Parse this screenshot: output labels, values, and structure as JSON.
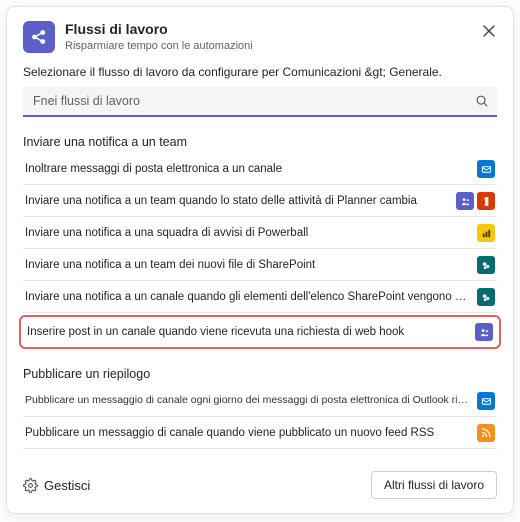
{
  "header": {
    "title": "Flussi di lavoro",
    "subtitle": "Risparmiare tempo con le automazioni"
  },
  "prompt": "Selezionare il flusso di lavoro da configurare per Comunicazioni &gt; Generale.",
  "search": {
    "placeholder": "Fnei flussi di lavoro"
  },
  "sections": [
    {
      "label": "Inviare una notifica a un team",
      "items": [
        {
          "label": "Inoltrare messaggi di posta elettronica a un canale",
          "badges": [
            {
              "name": "outlook",
              "bg": "#0078d4"
            }
          ],
          "small": false,
          "highlight": false
        },
        {
          "label": "Inviare una notifica a un team quando lo stato delle attività di Planner cambia",
          "badges": [
            {
              "name": "teams",
              "bg": "#5b5fc7"
            },
            {
              "name": "office",
              "bg": "#d83b01"
            }
          ],
          "small": false,
          "highlight": false
        },
        {
          "label": "Inviare una notifica a una squadra di avvisi di Powerball",
          "badges": [
            {
              "name": "powerbi",
              "bg": "#f2c811"
            }
          ],
          "small": false,
          "highlight": false
        },
        {
          "label": "Inviare una notifica a un team dei nuovi file di SharePoint",
          "badges": [
            {
              "name": "sharepoint",
              "bg": "#036c70"
            }
          ],
          "small": false,
          "highlight": false
        },
        {
          "label": "Inviare una notifica a un canale quando gli elementi dell'elenco SharePoint vengono modificati",
          "badges": [
            {
              "name": "sharepoint",
              "bg": "#036c70"
            }
          ],
          "small": false,
          "highlight": false
        },
        {
          "label": "Inserire post in un canale quando viene ricevuta una richiesta di web hook",
          "badges": [
            {
              "name": "teams",
              "bg": "#5b5fc7"
            }
          ],
          "small": false,
          "highlight": true
        }
      ]
    },
    {
      "label": "Pubblicare un riepilogo",
      "items": [
        {
          "label": "Pubblicare un messaggio di canale ogni giorno dei messaggi di posta elettronica di Outlook ricevuti e dei post di Teams",
          "badges": [
            {
              "name": "outlook",
              "bg": "#0078d4"
            }
          ],
          "small": true,
          "highlight": false
        },
        {
          "label": "Pubblicare un messaggio di canale quando viene pubblicato un nuovo feed RSS",
          "badges": [
            {
              "name": "rss",
              "bg": "#f7901e"
            }
          ],
          "small": false,
          "highlight": false
        }
      ]
    }
  ],
  "footer": {
    "manage": "Gestisci",
    "more": "Altri flussi di lavoro"
  },
  "icons": {
    "workflow": "share-nodes-icon",
    "close": "close-icon",
    "search": "search-icon",
    "gear": "gear-icon"
  }
}
